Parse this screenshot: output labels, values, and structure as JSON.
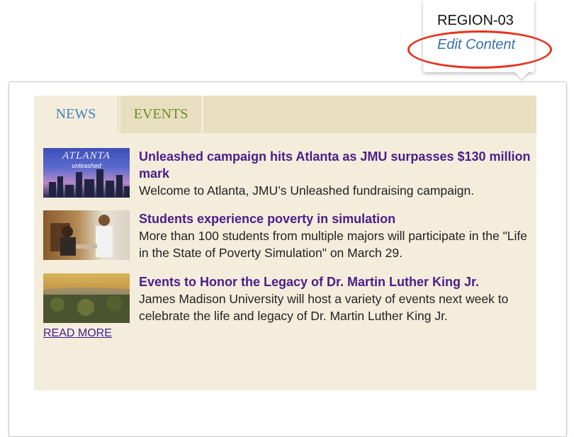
{
  "region_popup": {
    "region_name": "REGION-03",
    "edit_label": "Edit Content"
  },
  "tabs": [
    {
      "label": "NEWS",
      "active": true
    },
    {
      "label": "EVENTS",
      "active": false
    }
  ],
  "news": [
    {
      "title": "Unleashed campaign hits Atlanta as JMU surpasses $130 million mark",
      "description": "Welcome to Atlanta, JMU’s Unleashed fundraising campaign.",
      "thumb_text": "ATLANTA",
      "thumb_subtext": "unleashed"
    },
    {
      "title": "Students experience poverty in simulation",
      "description": "More than 100 students from multiple majors will participate in the \"Life in the State of Poverty Simulation\" on March 29."
    },
    {
      "title": "Events to Honor the Legacy of Dr. Martin Luther King Jr.",
      "description": "James Madison University will host a variety of events next week to celebrate the life and legacy of Dr. Martin Luther King Jr."
    }
  ],
  "read_more_label": "READ MORE",
  "colors": {
    "accent_circle": "#e8321c",
    "panel_bg": "#f5eddc",
    "tab_bar": "#e7dfbf",
    "news_tab_text": "#3e82b8",
    "events_tab_text": "#6e8b25",
    "title_link": "#4b1d8a"
  }
}
